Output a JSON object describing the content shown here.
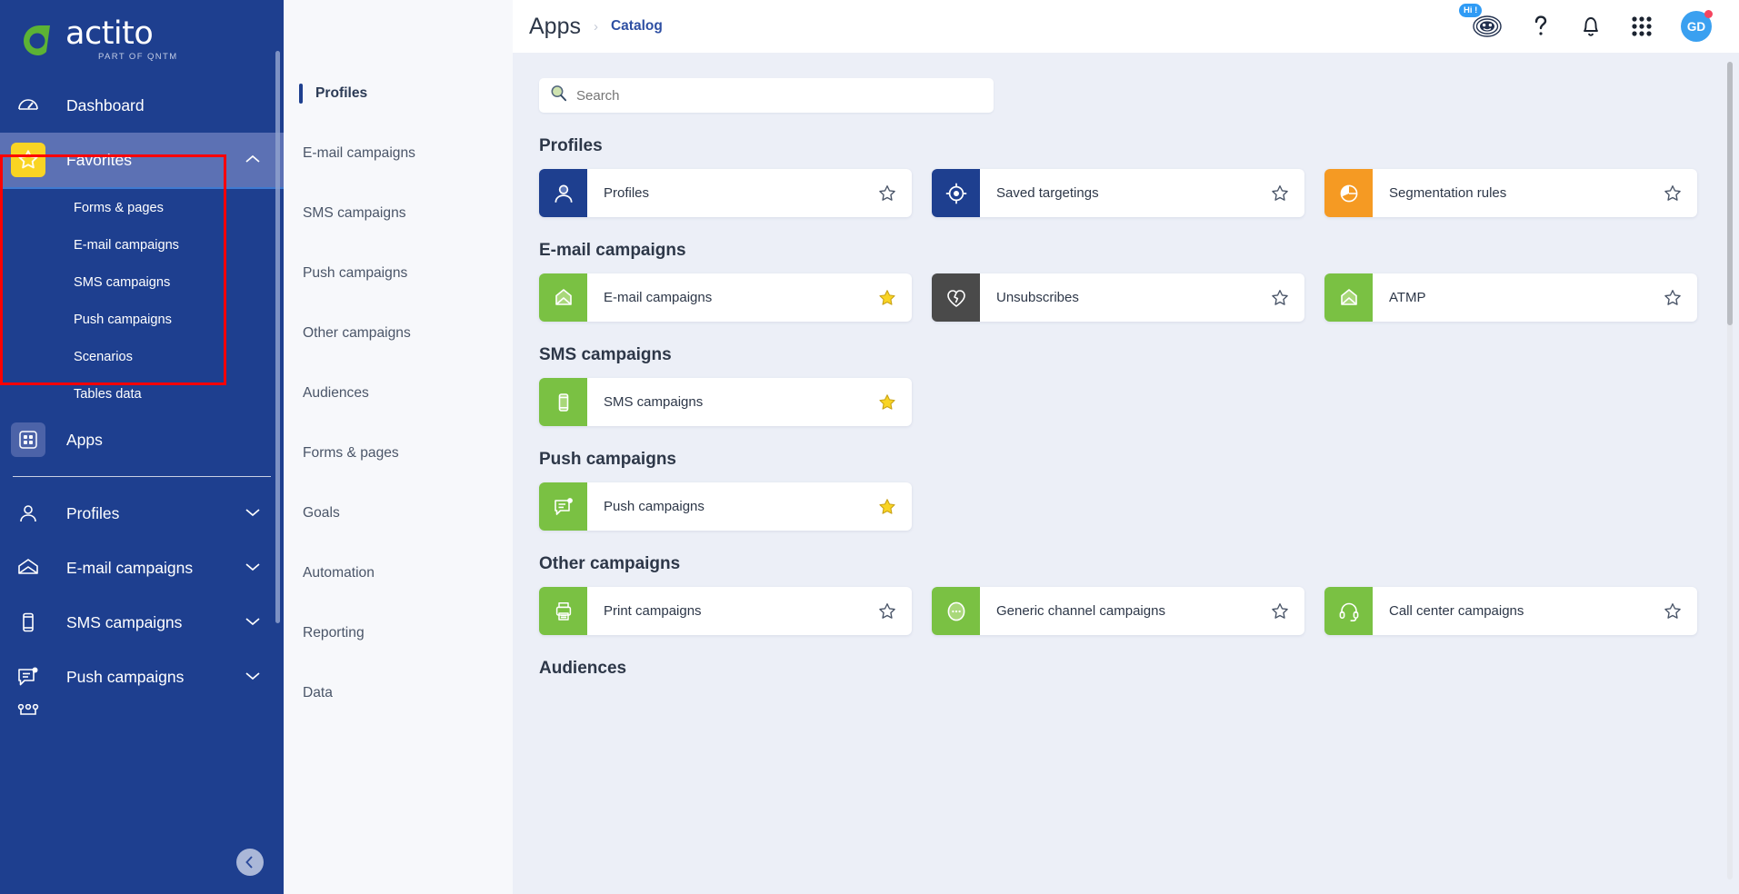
{
  "brand": {
    "name": "actito",
    "tagline": "PART OF  QNTM",
    "green": "#5cb335",
    "navy": "#1e3f8f"
  },
  "sidebar": {
    "dashboard": {
      "label": "Dashboard",
      "icon": "gauge-icon"
    },
    "favorites": {
      "label": "Favorites",
      "icon": "star-icon",
      "expanded": true
    },
    "favorites_children": [
      {
        "label": "Forms & pages"
      },
      {
        "label": "E-mail campaigns"
      },
      {
        "label": "SMS campaigns"
      },
      {
        "label": "Push campaigns"
      },
      {
        "label": "Scenarios"
      },
      {
        "label": "Tables data"
      }
    ],
    "apps": {
      "label": "Apps",
      "icon": "apps-grid-icon"
    },
    "items": [
      {
        "label": "Profiles",
        "icon": "person-icon"
      },
      {
        "label": "E-mail campaigns",
        "icon": "envelope-icon"
      },
      {
        "label": "SMS campaigns",
        "icon": "phone-icon"
      },
      {
        "label": "Push campaigns",
        "icon": "push-message-icon"
      }
    ],
    "collapse_icon": "chevron-left-icon"
  },
  "subnav": {
    "items": [
      {
        "label": "Profiles",
        "active": true
      },
      {
        "label": "E-mail campaigns",
        "active": false
      },
      {
        "label": "SMS campaigns",
        "active": false
      },
      {
        "label": "Push campaigns",
        "active": false
      },
      {
        "label": "Other campaigns",
        "active": false
      },
      {
        "label": "Audiences",
        "active": false
      },
      {
        "label": "Forms & pages",
        "active": false
      },
      {
        "label": "Goals",
        "active": false
      },
      {
        "label": "Automation",
        "active": false
      },
      {
        "label": "Reporting",
        "active": false
      },
      {
        "label": "Data",
        "active": false
      }
    ]
  },
  "header": {
    "title": "Apps",
    "separator": "›",
    "breadcrumb_link": "Catalog",
    "assistant": {
      "icon": "chatbot-icon",
      "badge": "Hi !"
    },
    "help": {
      "icon": "question-mark-icon"
    },
    "notifications": {
      "icon": "bell-icon"
    },
    "app_switcher": {
      "icon": "apps-grid-icon"
    },
    "avatar": {
      "initials": "GD",
      "has_alert_dot": true
    }
  },
  "search": {
    "placeholder": "Search",
    "value": "",
    "icon": "search-icon"
  },
  "sections": [
    {
      "title": "Profiles",
      "cards": [
        {
          "label": "Profiles",
          "icon": "person-icon",
          "tile_color": "#1e3f8f",
          "favorited": false
        },
        {
          "label": "Saved targetings",
          "icon": "target-icon",
          "tile_color": "#1e3f8f",
          "favorited": false
        },
        {
          "label": "Segmentation rules",
          "icon": "pie-chart-icon",
          "tile_color": "#f59a23",
          "favorited": false
        }
      ]
    },
    {
      "title": "E-mail campaigns",
      "cards": [
        {
          "label": "E-mail campaigns",
          "icon": "envelope-icon",
          "tile_color": "#7ac143",
          "favorited": true
        },
        {
          "label": "Unsubscribes",
          "icon": "broken-heart-icon",
          "tile_color": "#4a4a4a",
          "favorited": false
        },
        {
          "label": "ATMP",
          "icon": "envelope-icon",
          "tile_color": "#7ac143",
          "favorited": false
        }
      ]
    },
    {
      "title": "SMS campaigns",
      "cards": [
        {
          "label": "SMS campaigns",
          "icon": "phone-icon",
          "tile_color": "#7ac143",
          "favorited": true
        }
      ]
    },
    {
      "title": "Push campaigns",
      "cards": [
        {
          "label": "Push campaigns",
          "icon": "push-message-icon",
          "tile_color": "#7ac143",
          "favorited": true
        }
      ]
    },
    {
      "title": "Other campaigns",
      "cards": [
        {
          "label": "Print campaigns",
          "icon": "printer-icon",
          "tile_color": "#7ac143",
          "favorited": false
        },
        {
          "label": "Generic channel campaigns",
          "icon": "ellipsis-circle-icon",
          "tile_color": "#7ac143",
          "favorited": false
        },
        {
          "label": "Call center campaigns",
          "icon": "headset-icon",
          "tile_color": "#7ac143",
          "favorited": false
        }
      ]
    },
    {
      "title": "Audiences",
      "cards": []
    }
  ],
  "colors": {
    "star_active": "#f9d423",
    "star_inactive": "#4a5568",
    "highlight_box": "#ff0000",
    "page_bg": "#eceff7"
  }
}
